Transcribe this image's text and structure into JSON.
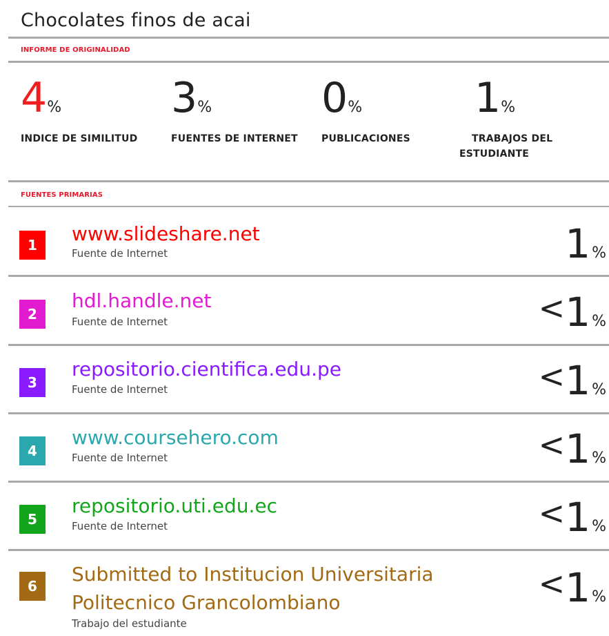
{
  "title": "Chocolates finos de acai",
  "report_label": "INFORME DE ORIGINALIDAD",
  "stats": [
    {
      "value": "4",
      "unit": "%",
      "label": "INDICE DE SIMILITUD"
    },
    {
      "value": "3",
      "unit": "%",
      "label": "FUENTES DE INTERNET"
    },
    {
      "value": "0",
      "unit": "%",
      "label": "PUBLICACIONES"
    },
    {
      "value": "1",
      "unit": "%",
      "label_line1": "TRABAJOS DEL",
      "label_line2": "ESTUDIANTE"
    }
  ],
  "sources_label": "FUENTES PRIMARIAS",
  "sources": [
    {
      "rank": "1",
      "name": "www.slideshare.net",
      "type": "Fuente de Internet",
      "prefix": "",
      "value": "1",
      "unit": "%",
      "color": "#ff0000"
    },
    {
      "rank": "2",
      "name": "hdl.handle.net",
      "type": "Fuente de Internet",
      "prefix": "<",
      "value": "1",
      "unit": "%",
      "color": "#e21bd1"
    },
    {
      "rank": "3",
      "name": "repositorio.cientifica.edu.pe",
      "type": "Fuente de Internet",
      "prefix": "<",
      "value": "1",
      "unit": "%",
      "color": "#8a1aff"
    },
    {
      "rank": "4",
      "name": "www.coursehero.com",
      "type": "Fuente de Internet",
      "prefix": "<",
      "value": "1",
      "unit": "%",
      "color": "#2aa8ad"
    },
    {
      "rank": "5",
      "name": "repositorio.uti.edu.ec",
      "type": "Fuente de Internet",
      "prefix": "<",
      "value": "1",
      "unit": "%",
      "color": "#13a51c"
    },
    {
      "rank": "6",
      "name_line1": "Submitted to Institucion Universitaria",
      "name_line2": "Politecnico Grancolombiano",
      "type": "Trabajo del estudiante",
      "prefix": "<",
      "value": "1",
      "unit": "%",
      "color": "#a36a14"
    }
  ]
}
